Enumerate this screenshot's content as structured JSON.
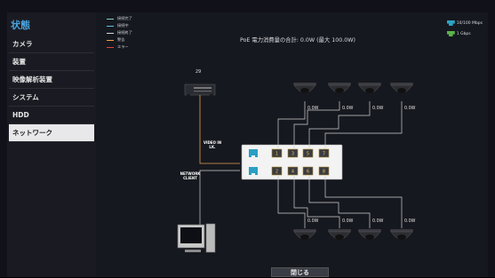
{
  "sidebar": {
    "title": "状態",
    "items": [
      {
        "label": "カメラ"
      },
      {
        "label": "装置"
      },
      {
        "label": "映像解析装置"
      },
      {
        "label": "システム"
      },
      {
        "label": "HDD"
      },
      {
        "label": "ネットワーク"
      }
    ]
  },
  "legend": [
    {
      "label": "接続完了",
      "color": "#7fd3c1"
    },
    {
      "label": "接続中",
      "color": "#58c6e6"
    },
    {
      "label": "接続終了",
      "color": "#d8d8d8"
    },
    {
      "label": "警告",
      "color": "#f0a040"
    },
    {
      "label": "エラー",
      "color": "#e04040"
    }
  ],
  "speed_legend": [
    {
      "label": "10/100 Mbps",
      "color": "#2ba3c4"
    },
    {
      "label": "1 Gbps",
      "color": "#5ab24a"
    }
  ],
  "poe_summary": "PoE 電力消費量の合計: 0.0W (最大 100.0W)",
  "nvr_label": "29",
  "video_in_label": "VIDEO IN",
  "video_in_sub": "LK.",
  "network_client_label": "NETWORK",
  "network_client_sub": "CLIENT",
  "switch_ports_top": [
    "1",
    "3",
    "5",
    "7"
  ],
  "switch_ports_bottom": [
    "2",
    "4",
    "6",
    "8"
  ],
  "poe_top": [
    "0.0W",
    "0.0W",
    "0.0W",
    "0.0W"
  ],
  "poe_bottom": [
    "0.0W",
    "0.0W",
    "0.0W",
    "0.0W"
  ],
  "close_label": "閉じる"
}
